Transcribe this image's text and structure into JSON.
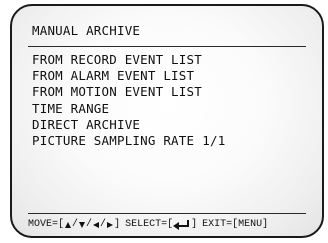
{
  "menu_title": "MANUAL ARCHIVE",
  "items": [
    {
      "label": "FROM RECORD EVENT LIST"
    },
    {
      "label": "FROM ALARM EVENT LIST"
    },
    {
      "label": "FROM MOTION EVENT LIST"
    },
    {
      "label": "TIME RANGE"
    },
    {
      "label": "DIRECT ARCHIVE"
    },
    {
      "label": "PICTURE SAMPLING RATE",
      "value": "1/1"
    }
  ],
  "status_bar": {
    "move_prefix": "MOVE=[",
    "sep": "/",
    "close": "]",
    "select_prefix": "SELECT=[",
    "exit": "EXIT=[MENU]",
    "icons": [
      "arrow-up-icon",
      "arrow-down-icon",
      "arrow-left-icon",
      "arrow-right-icon",
      "enter-icon"
    ]
  }
}
